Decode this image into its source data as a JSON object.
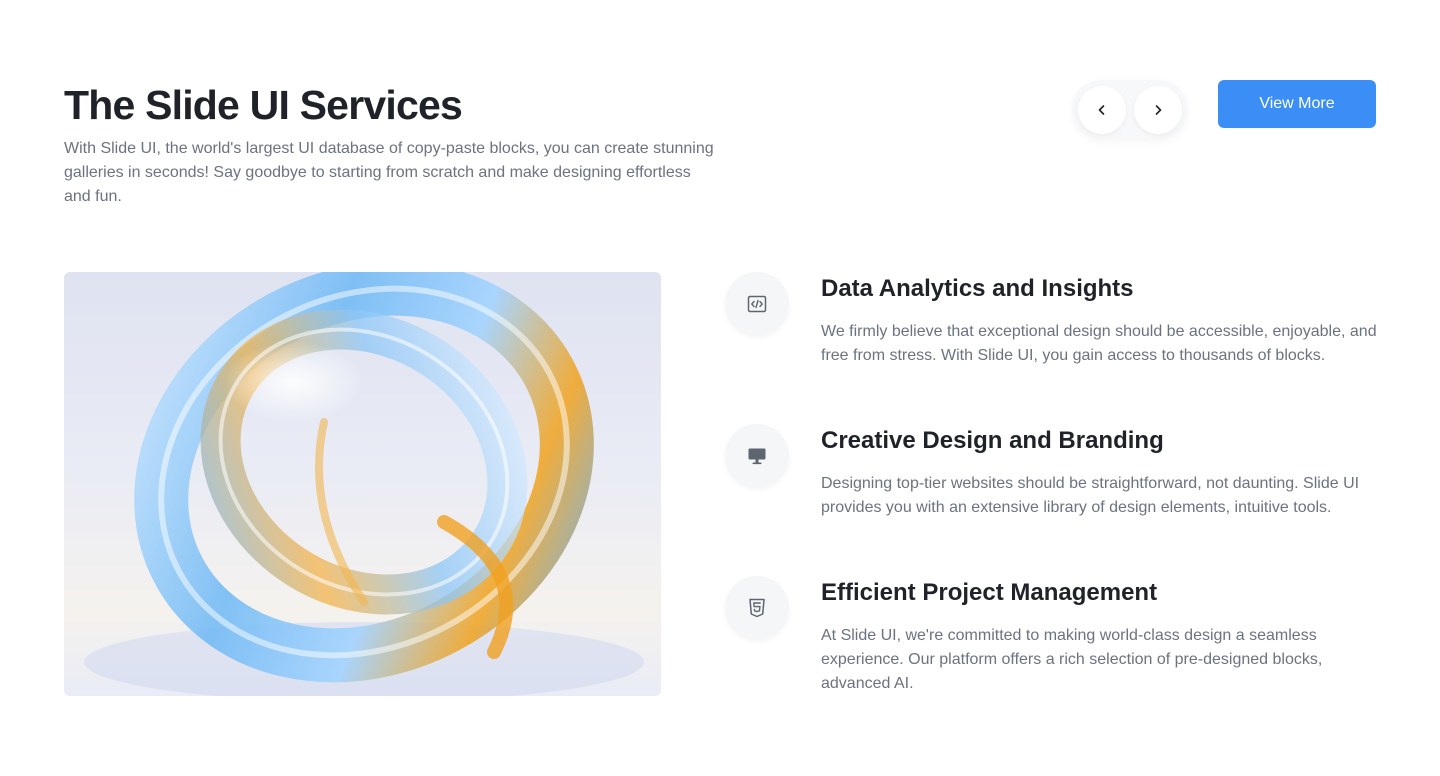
{
  "header": {
    "title": "The Slide UI Services",
    "subtitle": "With Slide UI, the world's largest UI database of copy-paste blocks, you can create stunning galleries in seconds! Say goodbye to starting from scratch and make designing effortless and fun."
  },
  "carousel": {
    "prev_icon": "chevron-left-icon",
    "next_icon": "chevron-right-icon"
  },
  "actions": {
    "view_more_label": "View More"
  },
  "colors": {
    "accent": "#3b8ef5",
    "heading": "#1f2329",
    "body": "#6b7280"
  },
  "features": [
    {
      "icon": "code-icon",
      "title": "Data Analytics and Insights",
      "description": "We firmly believe that exceptional design should be accessible, enjoyable, and free from stress. With Slide UI, you gain access to thousands of blocks."
    },
    {
      "icon": "monitor-icon",
      "title": "Creative Design and Branding",
      "description": "Designing top-tier websites should be straightforward, not daunting. Slide UI provides you with an extensive library of design elements, intuitive tools."
    },
    {
      "icon": "html5-icon",
      "title": "Efficient Project Management",
      "description": "At Slide UI, we're committed to making world-class design a seamless experience. Our platform offers a rich selection of pre-designed blocks, advanced AI."
    }
  ]
}
